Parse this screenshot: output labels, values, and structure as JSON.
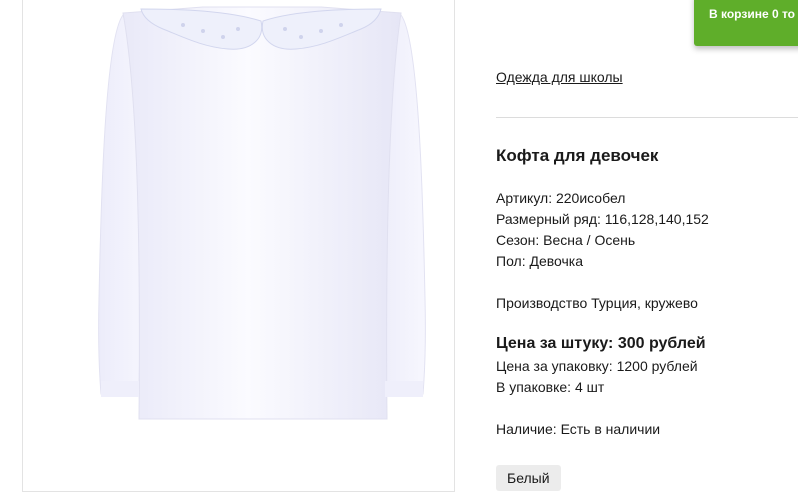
{
  "cart": {
    "label": "В корзине 0 то"
  },
  "breadcrumb": {
    "category": "Одежда для школы"
  },
  "product": {
    "title": "Кофта для девочек",
    "article": "Артикул: 220исобел",
    "sizes": "Размерный ряд: 116,128,140,152",
    "season": "Сезон: Весна / Осень",
    "gender": "Пол: Девочка",
    "production": "Производство Турция, кружево",
    "price_per_item": "Цена за штуку: 300 рублей",
    "price_per_pack": "Цена за упаковку: 1200 рублей",
    "pack_count": "В упаковке: 4 шт",
    "availability": "Наличие: Есть в наличии",
    "color_option": "Белый"
  }
}
